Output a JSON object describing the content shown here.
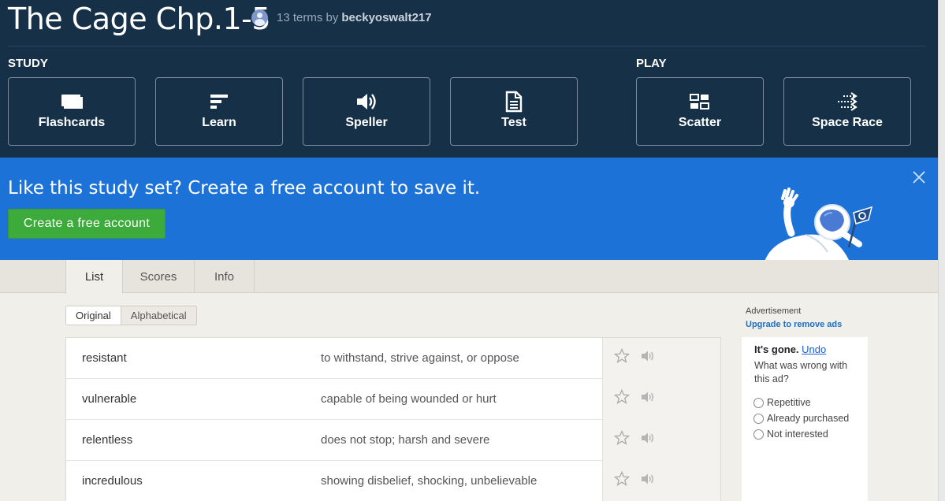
{
  "set": {
    "title": "The Cage Chp.1-5",
    "terms_count_text": "13 terms by",
    "author": "beckyoswalt217"
  },
  "study": {
    "label": "STUDY",
    "modes": [
      {
        "label": "Flashcards",
        "icon": "flashcards-icon"
      },
      {
        "label": "Learn",
        "icon": "learn-icon"
      },
      {
        "label": "Speller",
        "icon": "speaker-icon"
      },
      {
        "label": "Test",
        "icon": "document-icon"
      }
    ]
  },
  "play": {
    "label": "PLAY",
    "modes": [
      {
        "label": "Scatter",
        "icon": "scatter-icon"
      },
      {
        "label": "Space Race",
        "icon": "space-race-icon"
      }
    ]
  },
  "banner": {
    "text": "Like this study set? Create a free account to save it.",
    "button": "Create a free account"
  },
  "tabs": [
    {
      "label": "List",
      "active": true
    },
    {
      "label": "Scores",
      "active": false
    },
    {
      "label": "Info",
      "active": false
    }
  ],
  "sort": {
    "original": "Original",
    "alphabetical": "Alphabetical"
  },
  "terms": [
    {
      "word": "resistant",
      "definition": "to withstand, strive against, or oppose"
    },
    {
      "word": "vulnerable",
      "definition": "capable of being wounded or hurt"
    },
    {
      "word": "relentless",
      "definition": "does not stop; harsh and severe"
    },
    {
      "word": "incredulous",
      "definition": "showing disbelief, shocking, unbelievable"
    }
  ],
  "ad": {
    "label": "Advertisement",
    "upgrade": "Upgrade to remove ads",
    "gone": "It's gone.",
    "undo": "Undo",
    "question": "What was wrong with this ad?",
    "options": [
      "Repetitive",
      "Already purchased",
      "Not interested"
    ]
  },
  "colors": {
    "header_bg": "#163047",
    "banner_bg": "#1d72d8",
    "create_button": "#3cab3b",
    "page_bg": "#f0efe9"
  }
}
